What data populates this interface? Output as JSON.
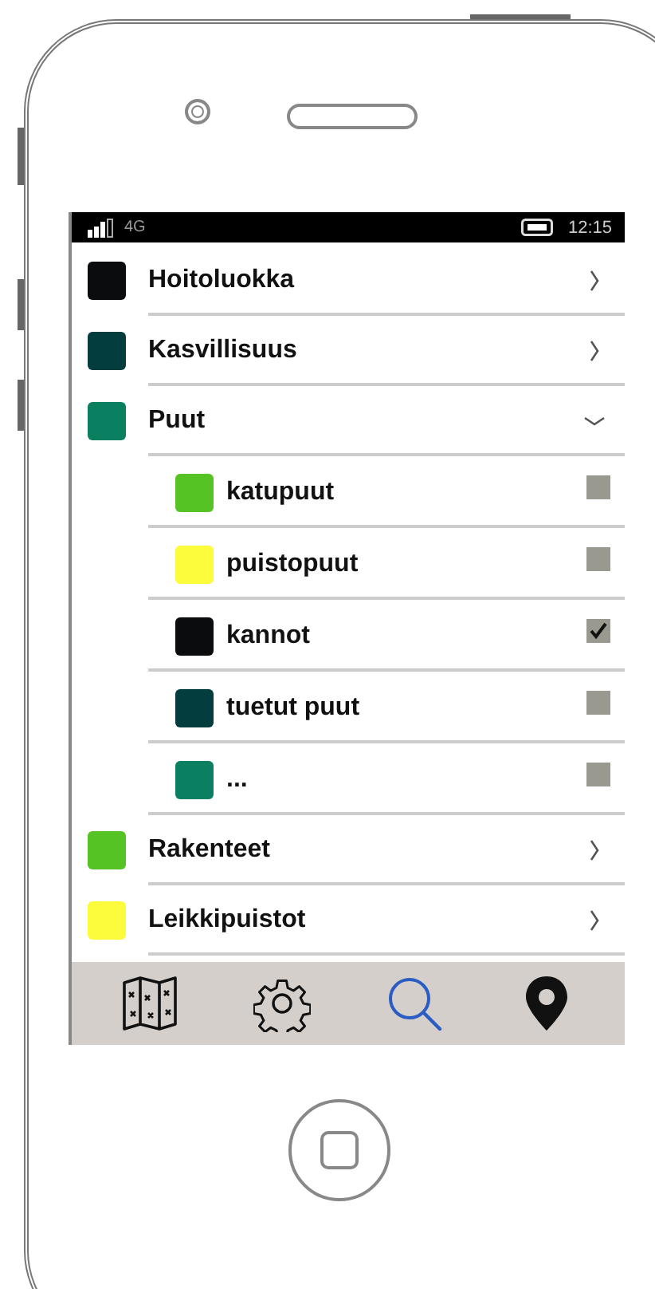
{
  "status_bar": {
    "network": "4G",
    "time": "12:15"
  },
  "categories": [
    {
      "name": "Hoitoluokka",
      "color": "#0b0c0e",
      "expanded": false
    },
    {
      "name": "Kasvillisuus",
      "color": "#033d3e",
      "expanded": false
    },
    {
      "name": "Puut",
      "color": "#0b8060",
      "expanded": true,
      "children": [
        {
          "name": "katupuut",
          "color": "#55c324",
          "checked": false
        },
        {
          "name": "puistopuut",
          "color": "#fdfc3c",
          "checked": false
        },
        {
          "name": "kannot",
          "color": "#0b0c0e",
          "checked": true
        },
        {
          "name": "tuetut puut",
          "color": "#033d3e",
          "checked": false
        },
        {
          "name": "...",
          "color": "#0b8060",
          "checked": false
        }
      ]
    },
    {
      "name": "Rakenteet",
      "color": "#55c324",
      "expanded": false
    },
    {
      "name": "Leikkipuistot",
      "color": "#fdfc3c",
      "expanded": false
    }
  ],
  "nav": [
    {
      "kind": "map",
      "selected": false
    },
    {
      "kind": "settings",
      "selected": false
    },
    {
      "kind": "search",
      "selected": true
    },
    {
      "kind": "location",
      "selected": false
    }
  ]
}
